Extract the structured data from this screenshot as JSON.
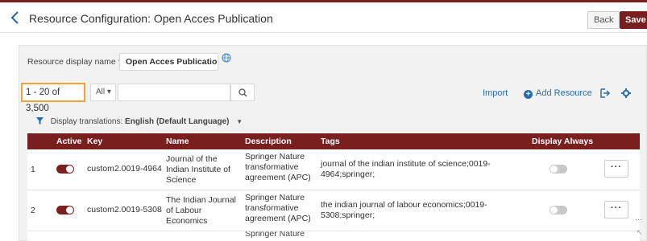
{
  "header": {
    "title": "Resource Configuration: Open Acces Publication",
    "back_label": "Back",
    "save_label": "Save",
    "accent_color": "#7a1f1f"
  },
  "form": {
    "display_name_label": "Resource display name",
    "required_mark": "*",
    "display_name_value": "Open Acces Publicatior"
  },
  "toolbar": {
    "count": "1 - 20 of 3,500",
    "filter_select": "All",
    "search_value": "",
    "import_label": "Import",
    "add_resource_label": "Add Resource"
  },
  "translations": {
    "label": "Display translations:",
    "value": "English (Default Language)"
  },
  "table": {
    "columns": [
      "Active",
      "Key",
      "Name",
      "Description",
      "Tags",
      "Display Always"
    ],
    "rows": [
      {
        "num": "1",
        "active": true,
        "key": "custom2.0019-4964",
        "name": "Journal of the Indian Institute of Science",
        "description": "Springer Nature transformative agreement (APC)",
        "tags": "journal of the indian institute of science;0019-4964;springer;",
        "display_always": false,
        "more": "···"
      },
      {
        "num": "2",
        "active": true,
        "key": "custom2.0019-5308",
        "name": "The Indian Journal of Labour Economics",
        "description": "Springer Nature transformative agreement (APC)",
        "tags": "the indian journal of labour economics;0019-5308;springer;",
        "display_always": false,
        "more": "···"
      }
    ],
    "partial_row_description": "Springer Nature"
  },
  "icons": [
    "chevron-left-icon",
    "globe-icon",
    "search-icon",
    "plus-circle-icon",
    "export-icon",
    "gear-icon",
    "filter-icon",
    "caret-down-icon"
  ]
}
